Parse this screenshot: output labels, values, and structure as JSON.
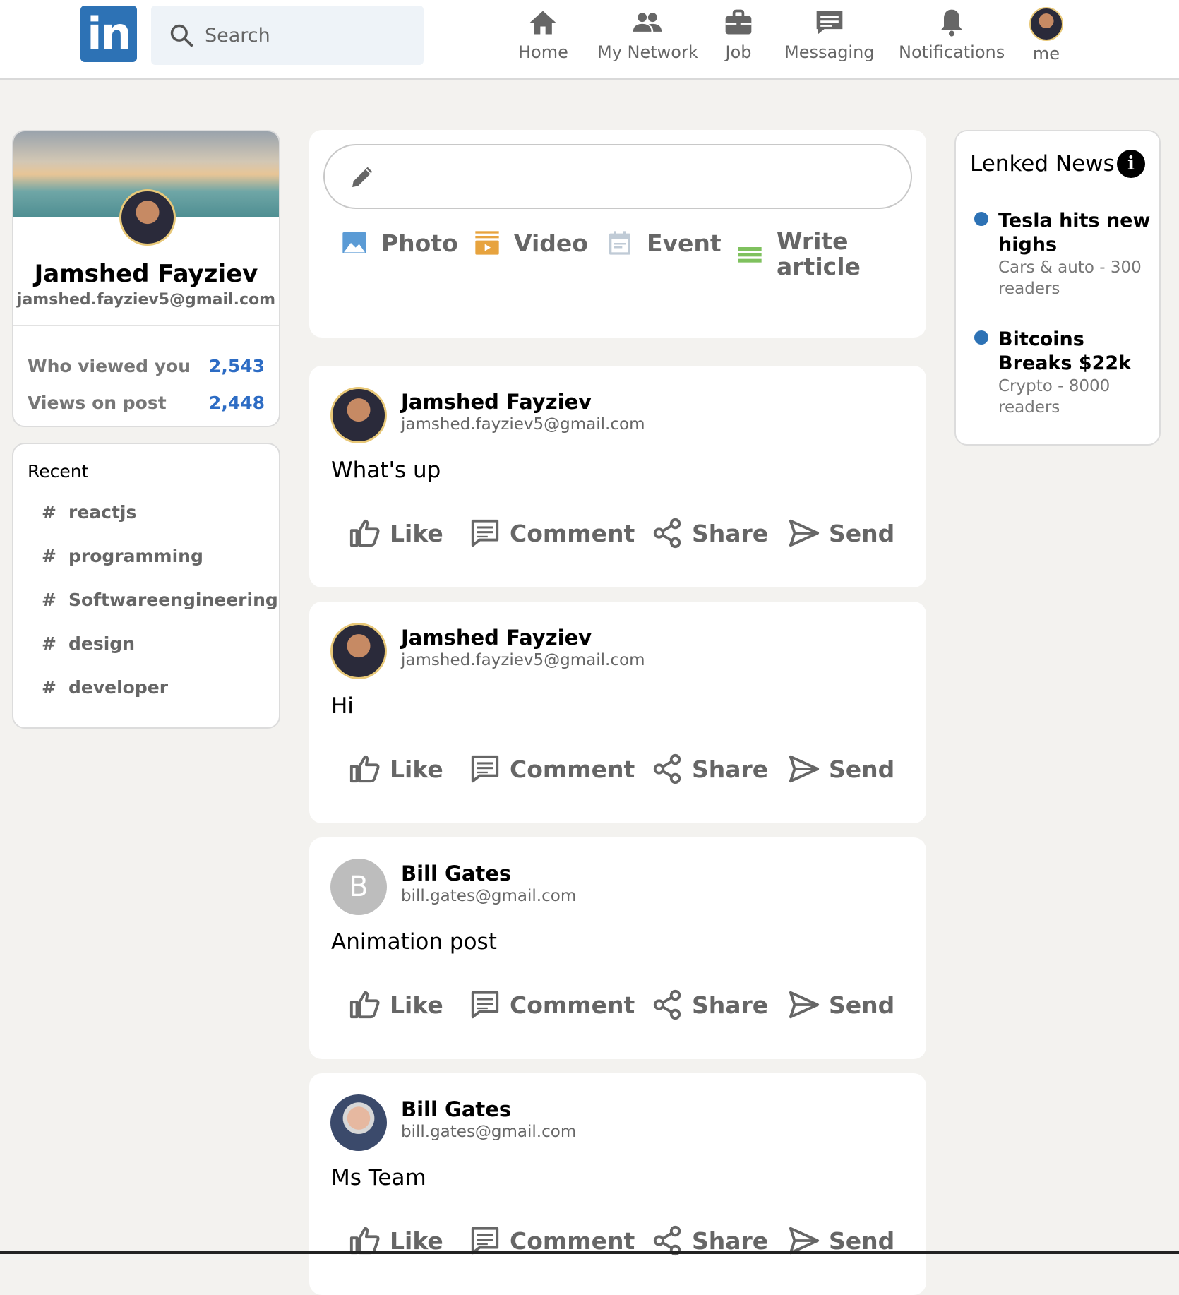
{
  "header": {
    "logo_text": "in",
    "search_placeholder": "Search",
    "nav": [
      {
        "label": "Home",
        "icon": "home-icon"
      },
      {
        "label": "My Network",
        "icon": "network-icon"
      },
      {
        "label": "Job",
        "icon": "briefcase-icon"
      },
      {
        "label": "Messaging",
        "icon": "message-icon"
      },
      {
        "label": "Notifications",
        "icon": "bell-icon"
      },
      {
        "label": "me",
        "icon": "avatar"
      }
    ]
  },
  "profile": {
    "name": "Jamshed Fayziev",
    "email": "jamshed.fayziev5@gmail.com",
    "stats": [
      {
        "label": "Who viewed you",
        "value": "2,543"
      },
      {
        "label": "Views on post",
        "value": "2,448"
      }
    ]
  },
  "recent": {
    "title": "Recent",
    "tags": [
      {
        "hash": "#",
        "label": "reactjs"
      },
      {
        "hash": "#",
        "label": "programming"
      },
      {
        "hash": "#",
        "label": "Softwareengineering"
      },
      {
        "hash": "#",
        "label": "design"
      },
      {
        "hash": "#",
        "label": "developer"
      }
    ]
  },
  "composer": {
    "actions": [
      {
        "label": "Photo",
        "icon": "photo-icon",
        "color": "#5b9bd5"
      },
      {
        "label": "Video",
        "icon": "video-icon",
        "color": "#e7a33e"
      },
      {
        "label": "Event",
        "icon": "calendar-icon",
        "color": "#c0cbd6"
      },
      {
        "label": "Write\narticle",
        "icon": "article-icon",
        "color": "#7fc15e"
      }
    ]
  },
  "post_actions": [
    "Like",
    "Comment",
    "Share",
    "Send"
  ],
  "posts": [
    {
      "name": "Jamshed Fayziev",
      "email": "jamshed.fayziev5@gmail.com",
      "text": "What's up",
      "avatar": "photo"
    },
    {
      "name": "Jamshed Fayziev",
      "email": "jamshed.fayziev5@gmail.com",
      "text": "Hi",
      "avatar": "photo"
    },
    {
      "name": "Bill Gates",
      "email": "bill.gates@gmail.com",
      "text": "Animation post",
      "avatar": "B"
    },
    {
      "name": "Bill Gates",
      "email": "bill.gates@gmail.com",
      "text": "Ms Team",
      "avatar": "photo-bill"
    }
  ],
  "news": {
    "title": "Lenked News",
    "items": [
      {
        "headline": "Tesla hits new highs",
        "sub": "Cars & auto - 300 readers"
      },
      {
        "headline": "Bitcoins Breaks $22k",
        "sub": "Crypto - 8000 readers"
      }
    ]
  },
  "colors": {
    "brand": "#2d72b5",
    "stat": "#2d6cc4",
    "background": "#f3f2ef"
  }
}
